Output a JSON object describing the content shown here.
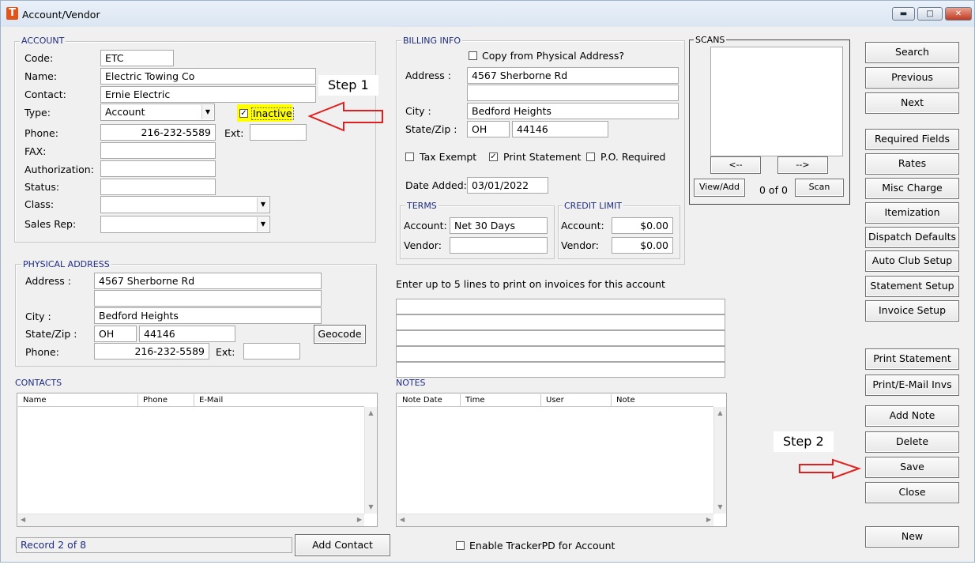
{
  "window": {
    "title": "Account/Vendor",
    "icon": "app-t-icon",
    "controls": [
      "minimize-icon",
      "maximize-icon",
      "close-icon"
    ]
  },
  "account": {
    "legend": "ACCOUNT",
    "code_label": "Code:",
    "code": "ETC",
    "name_label": "Name:",
    "name": "Electric Towing Co",
    "contact_label": "Contact:",
    "contact": "Ernie Electric",
    "type_label": "Type:",
    "type": "Account",
    "inactive_label": "Inactive",
    "inactive_checked": true,
    "phone_label": "Phone:",
    "phone": "216-232-5589",
    "ext_label": "Ext:",
    "ext": "",
    "fax_label": "FAX:",
    "fax": "",
    "authorization_label": "Authorization:",
    "authorization": "",
    "status_label": "Status:",
    "status": "",
    "class_label": "Class:",
    "class": "",
    "sales_rep_label": "Sales Rep:",
    "sales_rep": ""
  },
  "physical": {
    "legend": "PHYSICAL ADDRESS",
    "address_label": "Address :",
    "address1": "4567 Sherborne Rd",
    "address2": "",
    "city_label": "City :",
    "city": "Bedford Heights",
    "state_zip_label": "State/Zip :",
    "state": "OH",
    "zip": "44146",
    "geocode_button": "Geocode",
    "phone_label": "Phone:",
    "phone": "216-232-5589",
    "ext_label": "Ext:",
    "ext": ""
  },
  "billing": {
    "legend": "BILLING INFO",
    "copy_label": "Copy from Physical Address?",
    "copy_checked": false,
    "address_label": "Address :",
    "address1": "4567 Sherborne Rd",
    "address2": "",
    "city_label": "City :",
    "city": "Bedford Heights",
    "state_zip_label": "State/Zip :",
    "state": "OH",
    "zip": "44146",
    "tax_exempt_label": "Tax Exempt",
    "print_statement_label": "Print Statement",
    "po_required_label": "P.O. Required",
    "date_added_label": "Date Added:",
    "date_added": "03/01/2022",
    "terms": {
      "legend": "TERMS",
      "account_label": "Account:",
      "account": "Net 30 Days",
      "vendor_label": "Vendor:",
      "vendor": ""
    },
    "credit": {
      "legend": "CREDIT LIMIT",
      "account_label": "Account:",
      "account": "$0.00",
      "vendor_label": "Vendor:",
      "vendor": "$0.00"
    }
  },
  "scans": {
    "legend": "SCANS",
    "prev": "<--",
    "next": "-->",
    "view_add": "View/Add",
    "count": "0 of 0",
    "scan": "Scan"
  },
  "invoice_lines": {
    "label": "Enter up to 5 lines to print on invoices for this account"
  },
  "contacts": {
    "title": "CONTACTS",
    "columns": [
      "Name",
      "Phone",
      "E-Mail"
    ]
  },
  "notes": {
    "title": "NOTES",
    "columns": [
      "Note Date",
      "Time",
      "User",
      "Note"
    ]
  },
  "footer": {
    "record": "Record 2 of 8",
    "add_contact": "Add Contact",
    "tracker_label": "Enable TrackerPD for Account"
  },
  "buttons": {
    "search": "Search",
    "previous": "Previous",
    "next": "Next",
    "required_fields": "Required Fields",
    "rates": "Rates",
    "misc_charge": "Misc Charge",
    "itemization": "Itemization",
    "dispatch_defaults": "Dispatch Defaults",
    "auto_club_setup": "Auto Club Setup",
    "statement_setup": "Statement Setup",
    "invoice_setup": "Invoice Setup",
    "print_statement": "Print Statement",
    "print_email_invs": "Print/E-Mail Invs",
    "add_note": "Add Note",
    "delete": "Delete",
    "save": "Save",
    "close": "Close",
    "new": "New"
  },
  "annotations": {
    "step1": "Step 1",
    "step2": "Step 2",
    "highlight_color": "#ffff00",
    "arrow_color": "#e02020"
  }
}
